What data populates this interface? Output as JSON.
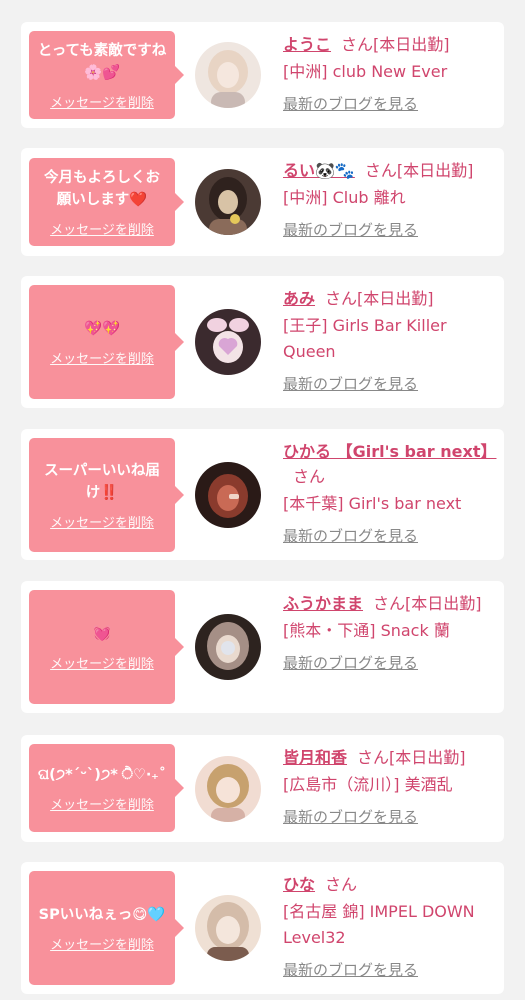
{
  "delete_label": "メッセージを削除",
  "blog_label": "最新のブログを見る",
  "cards": [
    {
      "message": "とっても素敵ですね🌸💕",
      "name": "ようこ",
      "suffix": "さん[本日出勤]",
      "shop": "[中洲] club New Ever",
      "avatar_colors": [
        "#efe6e0",
        "#c9b9b4",
        "#e8d4c4"
      ]
    },
    {
      "message": "今月もよろしくお願いします❤️",
      "name": "るい🐼🐾",
      "suffix": "さん[本日出勤]",
      "shop": "[中洲] Club 離れ",
      "avatar_colors": [
        "#4b3a34",
        "#8a6b5a",
        "#d8c3a6"
      ]
    },
    {
      "message": "💖💖",
      "name": "あみ",
      "suffix": "さん[本日出勤]",
      "shop": "[王子] Girls Bar Killer Queen",
      "avatar_colors": [
        "#3b2a2e",
        "#d9a5b5",
        "#f1d2e0"
      ]
    },
    {
      "message": "スーパーいいね届け‼️",
      "name": "ひかる 【Girl's bar next】",
      "suffix": "さん",
      "shop": "[本千葉] Girl's bar next",
      "avatar_colors": [
        "#2a1a17",
        "#8a3b2d",
        "#c96a55"
      ]
    },
    {
      "message": "💓",
      "name": "ふうかまま",
      "suffix": "さん[本日出勤]",
      "shop": "[熊本・下通] Snack 蘭",
      "avatar_colors": [
        "#2d231f",
        "#a58f86",
        "#e9dacf"
      ]
    },
    {
      "message": "ଘ(੭*ˊᵕˋ)੭* ੈ♡‧₊˚",
      "name": "皆月和香",
      "suffix": "さん[本日出勤]",
      "shop": "[広島市（流川）] 美酒乱",
      "avatar_colors": [
        "#d6b1a6",
        "#f1dcd2",
        "#c7a16e"
      ]
    },
    {
      "message": "SPいいねぇっ😋🩵",
      "name": "ひな",
      "suffix": "さん",
      "shop": "[名古屋 錦] IMPEL DOWN Level32",
      "avatar_colors": [
        "#d4bca9",
        "#7b5c4e",
        "#efe0d4"
      ]
    }
  ]
}
